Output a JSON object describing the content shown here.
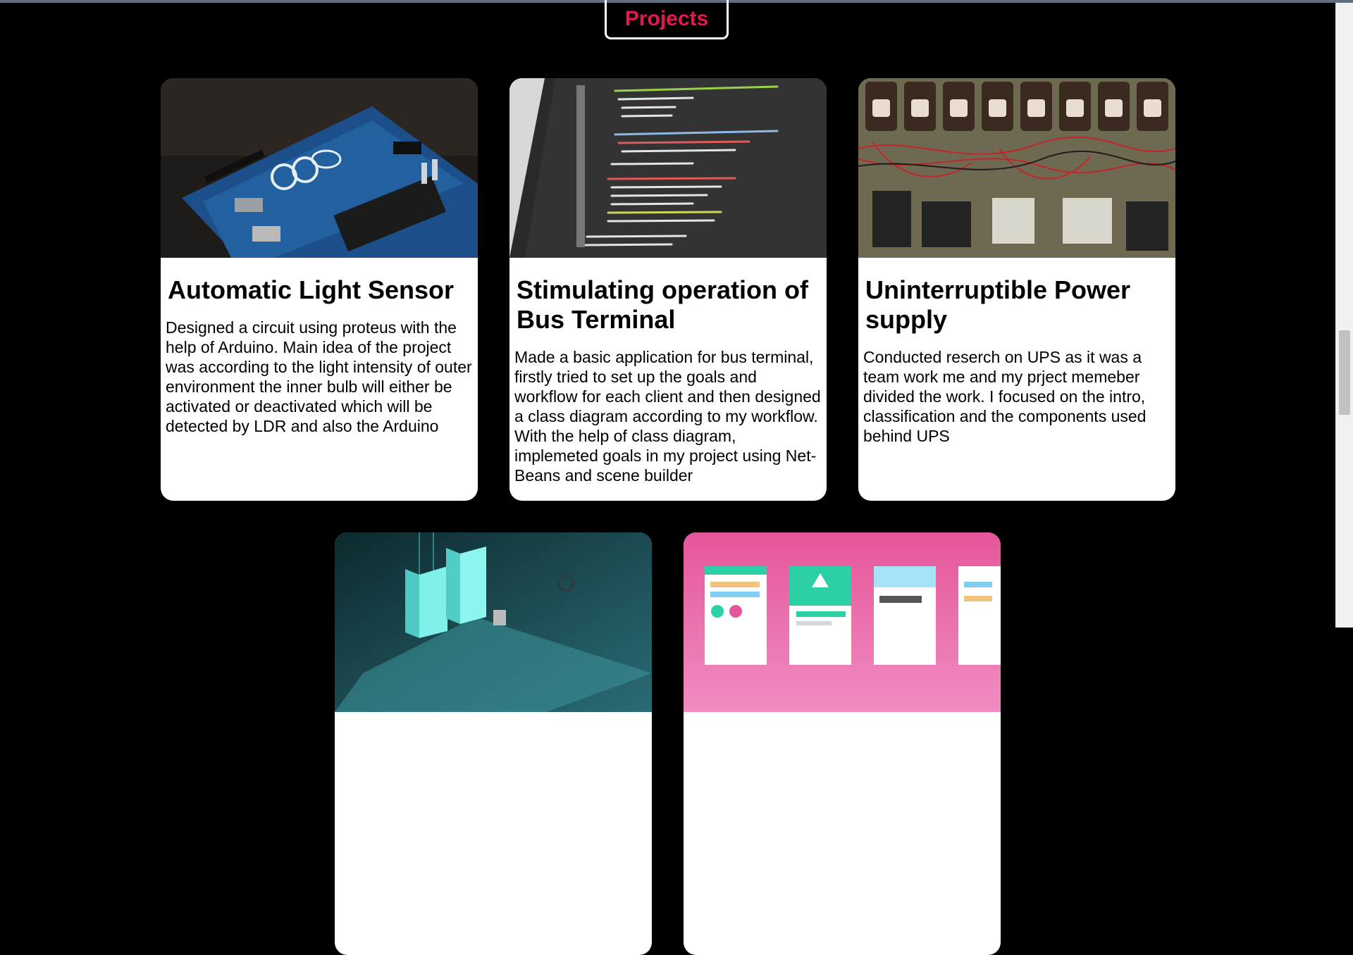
{
  "section": {
    "heading": "Projects"
  },
  "projects": [
    {
      "title": "Automatic Light Sensor",
      "description": "Designed a circuit using proteus with the help of Arduino. Main idea of the project was according to the light intensity of outer environment the inner bulb will either be activated or deactivated which will be detected by LDR and also the Arduino"
    },
    {
      "title": "Stimulating operation of Bus Terminal",
      "description": "Made a basic application for bus terminal, firstly tried to set up the goals and workflow for each client and then designed a class diagram according to my workflow. With the help of class diagram, implemeted goals in my project using Net-Beans and scene builder"
    },
    {
      "title": "Uninterruptible Power supply",
      "description": "Conducted reserch on UPS as it was a team work me and my prject memeber divided the work. I focused on the intro, classification and the components used behind UPS"
    }
  ],
  "colors": {
    "accent": "#e8164f",
    "background": "#000000",
    "card": "#ffffff"
  }
}
